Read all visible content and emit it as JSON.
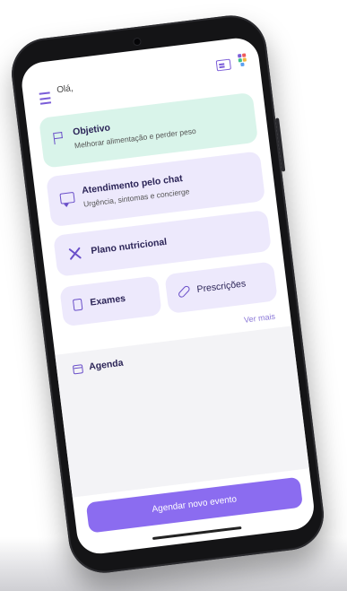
{
  "header": {
    "greeting": "Olá,"
  },
  "cards": {
    "objective": {
      "title": "Objetivo",
      "subtitle": "Melhorar alimentação e perder peso"
    },
    "chat": {
      "title": "Atendimento pelo chat",
      "subtitle": "Urgência, sintomas e concierge"
    },
    "nutrition": {
      "title": "Plano nutricional"
    },
    "exams": {
      "title": "Exames"
    },
    "prescriptions": {
      "title": "Prescrições"
    }
  },
  "agenda": {
    "see_more": "Ver mais",
    "title": "Agenda",
    "cta_label": "Agendar novo evento"
  },
  "colors": {
    "accent": "#8b6cf0",
    "card_lavender": "#ede9fc",
    "card_mint": "#d9f4ea"
  }
}
